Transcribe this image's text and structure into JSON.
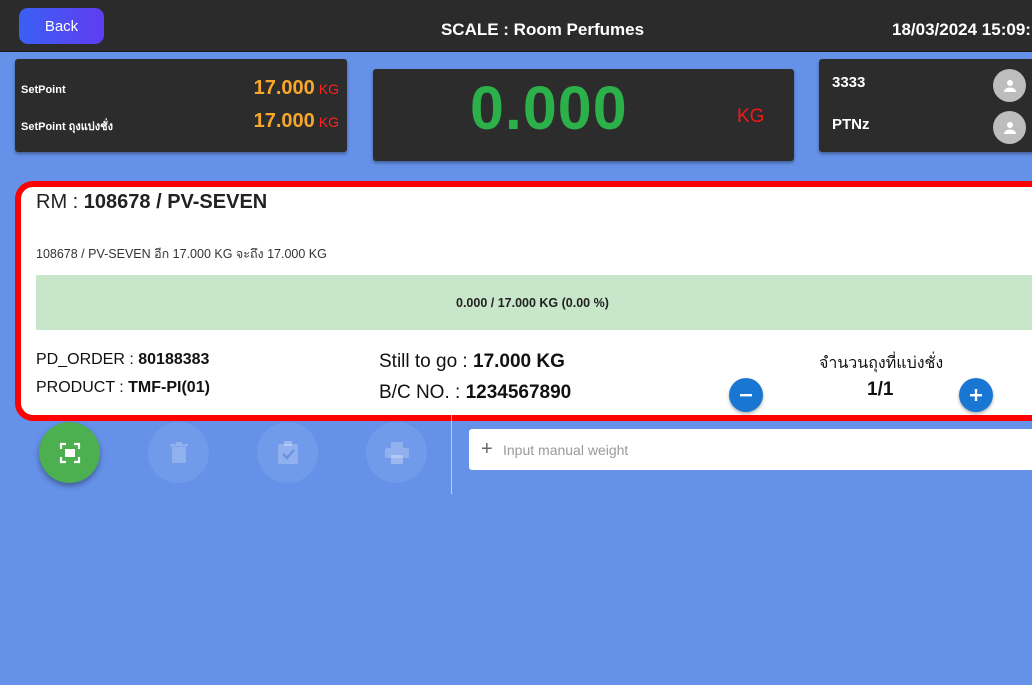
{
  "header": {
    "back_label": "Back",
    "title": "SCALE : Room Perfumes",
    "datetime": "18/03/2024 15:09:"
  },
  "setpoint": {
    "row1_label": "SetPoint",
    "row1_value": "17.000",
    "row2_label": "SetPoint ถุงแบ่งชั่ง",
    "row2_value": "17.000",
    "unit": "KG"
  },
  "scale": {
    "weight": "0.000",
    "unit": "KG"
  },
  "users": [
    {
      "name": "3333",
      "icon": "person-icon"
    },
    {
      "name": "PTNz",
      "icon": "person-icon"
    }
  ],
  "rm": {
    "title_prefix": "RM : ",
    "title_value": "108678 / PV-SEVEN",
    "subtitle": "108678 / PV-SEVEN อีก 17.000 KG จะถึง 17.000 KG",
    "progress_text": "0.000 / 17.000 KG (0.00 %)",
    "progress_fraction": 0,
    "pd_order_label": "PD_ORDER : ",
    "pd_order_value": "80188383",
    "product_label": "PRODUCT : ",
    "product_value": "TMF-PI(01)",
    "still_label": "Still to go : ",
    "still_value": "17.000 KG",
    "bc_label": "B/C NO. : ",
    "bc_value": "1234567890",
    "qty_label": "จำนวนถุงที่แบ่งชั่ง",
    "qty_value": "1/1"
  },
  "actions": {
    "scan_icon": "scan-icon",
    "delete_icon": "trash-icon",
    "confirm_icon": "clipboard-check-icon",
    "print_icon": "printer-icon",
    "manual_placeholder": "Input manual weight"
  },
  "colors": {
    "background": "#6591e8",
    "panel": "#2c2c2c",
    "setpoint_value": "#f7a72a",
    "unit_red": "#f21818",
    "weight_green": "#2bb04a",
    "card_border": "#ff0000",
    "progress_fill": "#c8e6c9",
    "button_blue": "#1976d2",
    "scan_green": "#4caf50"
  }
}
